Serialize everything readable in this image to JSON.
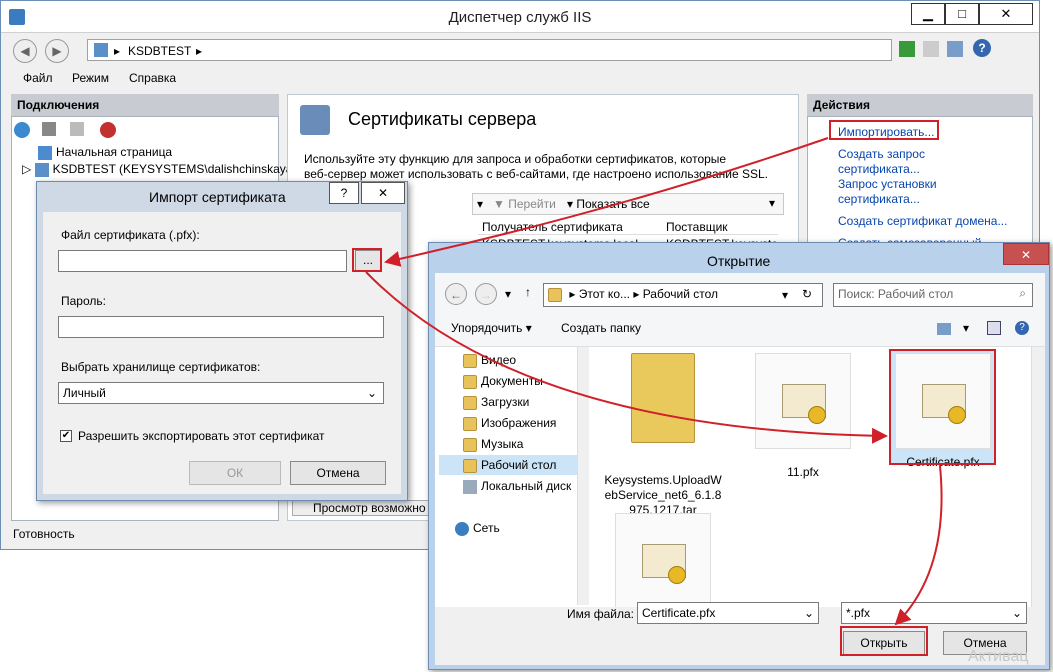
{
  "iis": {
    "title": "Диспетчер служб IIS",
    "address": "KSDBTEST",
    "menu": [
      "Файл",
      "Режим",
      "Справка"
    ],
    "connections": {
      "header": "Подключения",
      "items": [
        "Начальная страница",
        "KSDBTEST (KEYSYSTEMS\\dalishchinskaya)"
      ]
    },
    "main": {
      "title": "Сертификаты сервера",
      "description_line1": "Используйте эту функцию для запроса и обработки сертификатов, которые",
      "description_line2": "веб-сервер может использовать с веб-сайтами, где настроено использование SSL.",
      "go_label": "Перейти",
      "show_all_label": "Показать все",
      "columns": [
        "Получатель сертификата",
        "Поставщик"
      ],
      "row": [
        "KSDBTEST.keysystems.local",
        "KSDBTEST.keysystems"
      ],
      "bottom_link": "Просмотр возможно"
    },
    "actions": {
      "header": "Действия",
      "items": [
        "Импортировать...",
        "Создать запрос",
        "сертификата...",
        "Запрос установки",
        "сертификата...",
        "Создать сертификат домена...",
        "Создать самозаверенный"
      ]
    },
    "status": "Готовность"
  },
  "import_dialog": {
    "title": "Импорт сертификата",
    "help": "?",
    "close": "✕",
    "file_label": "Файл сертификата (.pfx):",
    "browse": "...",
    "password_label": "Пароль:",
    "store_label": "Выбрать хранилище сертификатов:",
    "store_value": "Личный",
    "checkbox_label": "Разрешить экспортировать этот сертификат",
    "ok": "ОК",
    "cancel": "Отмена"
  },
  "open_dialog": {
    "title": "Открытие",
    "close": "✕",
    "path": [
      "Этот ко...",
      "Рабочий стол"
    ],
    "search_placeholder": "Поиск: Рабочий стол",
    "organize": "Упорядочить",
    "new_folder": "Создать папку",
    "tree": [
      "Видео",
      "Документы",
      "Загрузки",
      "Изображения",
      "Музыка",
      "Рабочий стол",
      "Локальный диск",
      "Сеть"
    ],
    "files": [
      "Keysystems.UploadWebService_net6_6.1.8975.1217.tar",
      "11.pfx",
      "Certificate.pfx",
      ""
    ],
    "filename_label": "Имя файла:",
    "filename_value": "Certificate.pfx",
    "filter": "*.pfx",
    "open": "Открыть",
    "cancel": "Отмена"
  },
  "watermark": "Активац",
  "accent": "#d0202a"
}
